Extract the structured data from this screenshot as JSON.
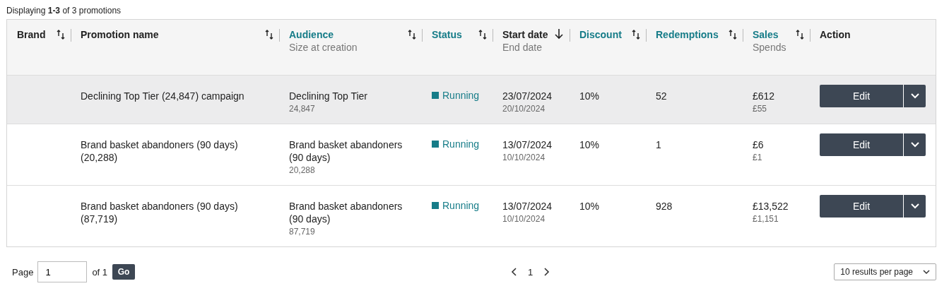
{
  "summary": "Displaying **1-3** of 3 promotions",
  "columns": [
    {
      "title": "Brand",
      "kind": "sortable",
      "link": false
    },
    {
      "title": "Promotion name",
      "kind": "sortable",
      "link": false
    },
    {
      "title": "Audience",
      "subtitle": "Size at creation",
      "kind": "sortable",
      "link": true
    },
    {
      "title": "Status",
      "kind": "sortable",
      "link": true
    },
    {
      "title": "Start date",
      "subtitle": "End date",
      "kind": "sorted",
      "link": false
    },
    {
      "title": "Discount",
      "kind": "sortable",
      "link": true
    },
    {
      "title": "Redemptions",
      "kind": "sortable",
      "link": true
    },
    {
      "title": "Sales",
      "subtitle": "Spends",
      "kind": "sortable",
      "link": true
    },
    {
      "title": "Action",
      "kind": "plain",
      "link": false
    }
  ],
  "rows": [
    {
      "selected": true,
      "promotion": "Declining Top Tier (24,847) campaign",
      "audience": "Declining Top Tier",
      "size": "24,847",
      "status": "Running",
      "start": "23/07/2024",
      "end": "20/10/2024",
      "discount": "10%",
      "redemptions": "52",
      "sales": "£612",
      "spends": "£55",
      "action": "Edit"
    },
    {
      "selected": false,
      "promotion": "Brand basket abandoners (90 days) (20,288)",
      "audience": "Brand basket abandoners (90 days)",
      "size": "20,288",
      "status": "Running",
      "start": "13/07/2024",
      "end": "10/10/2024",
      "discount": "10%",
      "redemptions": "1",
      "sales": "£6",
      "spends": "£1",
      "action": "Edit"
    },
    {
      "selected": false,
      "promotion": "Brand basket abandoners (90 days) (87,719)",
      "audience": "Brand basket abandoners (90 days)",
      "size": "87,719",
      "status": "Running",
      "start": "13/07/2024",
      "end": "10/10/2024",
      "discount": "10%",
      "redemptions": "928",
      "sales": "£13,522",
      "spends": "£1,151",
      "action": "Edit"
    }
  ],
  "pagination": {
    "page_label": "Page",
    "page_value": "1",
    "of_label": "of 1",
    "go": "Go",
    "current": "1",
    "per_page": "10 results per page"
  }
}
